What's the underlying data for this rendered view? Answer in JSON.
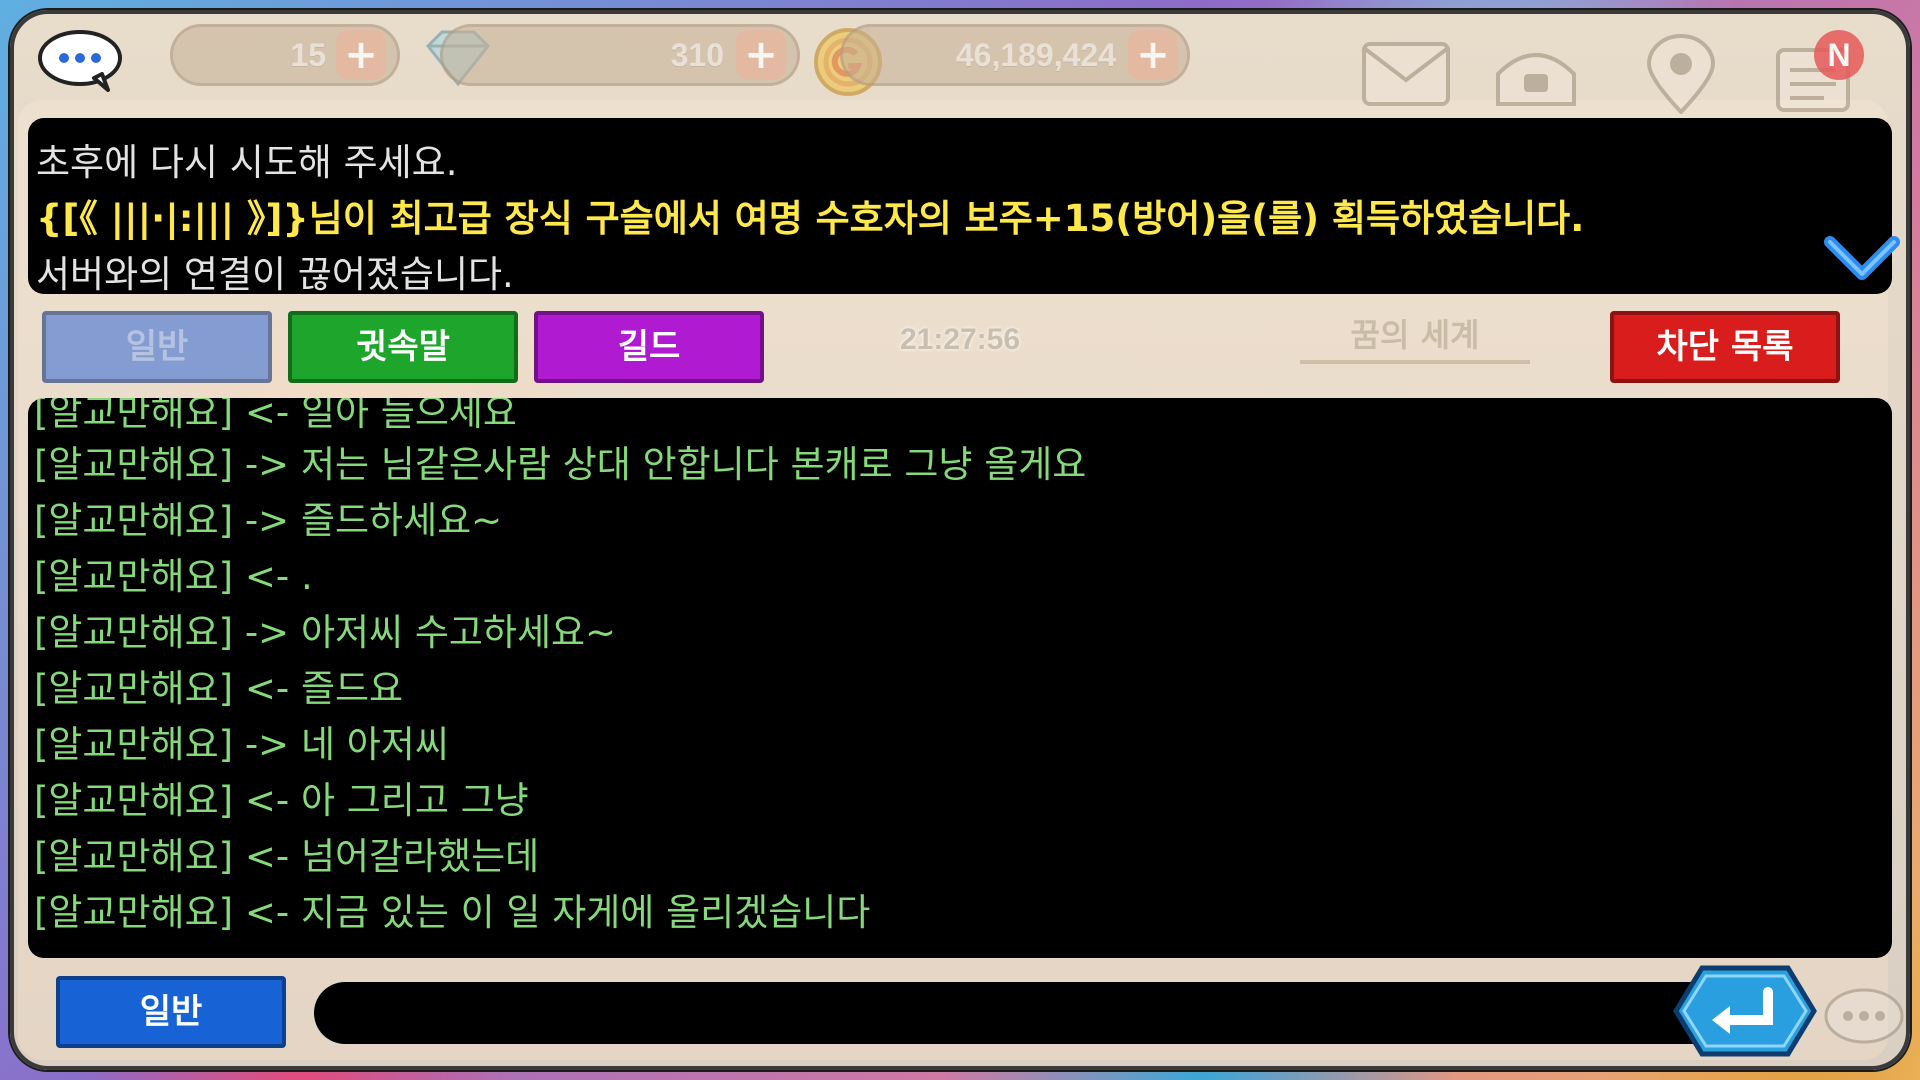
{
  "resources": {
    "first_value": "15",
    "gems": "310",
    "gold": "46,189,424",
    "plus_label": "+",
    "notification_badge": "N"
  },
  "system_messages": [
    {
      "text": "초후에 다시 시도해 주세요.",
      "color": "gray"
    },
    {
      "text": "{[《 |||·|:||| 》]}님이 최고급 장식 구슬에서 여명 수호자의 보주+15(방어)을(를) 획득하였습니다.",
      "color": "yellow"
    },
    {
      "text": "서버와의 연결이 끊어졌습니다.",
      "color": "gray"
    }
  ],
  "tabs": {
    "general": "일반",
    "whisper": "귓속말",
    "guild": "길드",
    "block_list": "차단 목록"
  },
  "timestamp": "21:27:56",
  "world_label": "꿈의 세계",
  "chat_lines": [
    "[알교만해요] <- 일아 들으세요",
    "[알교만해요] -> 저는 님같은사람 상대 안합니다 본캐로 그냥 올게요",
    "[알교만해요] -> 즐드하세요~",
    "[알교만해요] <- .",
    "[알교만해요] -> 아저씨 수고하세요~",
    "[알교만해요] <- 즐드요",
    "[알교만해요] -> 네 아저씨",
    "[알교만해요] <- 아 그리고 그냥",
    "[알교만해요] <- 넘어갈라했는데",
    "[알교만해요] <- 지금 있는 이 일 자게에 올리겠습니다"
  ],
  "input": {
    "mode_label": "일반",
    "value": "",
    "placeholder": ""
  },
  "colors": {
    "chat_text": "#85d97b",
    "system_yellow": "#ffe94a",
    "tab_whisper": "#1ea52b",
    "tab_guild": "#b01bd2",
    "tab_block": "#d91d1d",
    "mode_button": "#1763d6"
  }
}
